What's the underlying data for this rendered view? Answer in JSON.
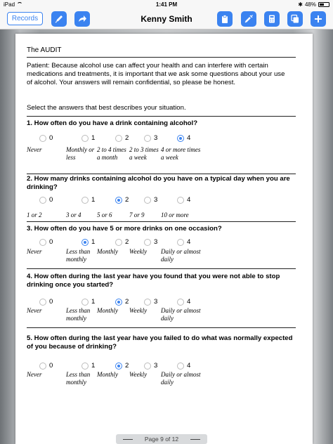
{
  "status_bar": {
    "device": "iPad",
    "time": "1:41 PM",
    "battery": "48%"
  },
  "toolbar": {
    "records_label": "Records",
    "title": "Kenny Smith"
  },
  "document": {
    "title": "The AUDIT",
    "intro": "Patient: Because alcohol use can affect your health and can interfere with certain medications and treatments, it is important that we ask some questions about your use of alcohol. Your answers will remain confidential, so please be honest.",
    "instruction": "Select the answers that best describes your situation.",
    "questions": [
      {
        "text": "1. How often do you have a drink containing alcohol?",
        "options": [
          "0",
          "1",
          "2",
          "3",
          "4"
        ],
        "labels": [
          "Never",
          "Monthly or less",
          "2 to 4 times a month",
          "2 to 3 times a week",
          "4 or more times a week"
        ],
        "selected": 4
      },
      {
        "text": "2. How many drinks containing alcohol do you have on a typical day when you are drinking?",
        "options": [
          "0",
          "1",
          "2",
          "3",
          "4"
        ],
        "labels": [
          "1 or 2",
          "3 or 4",
          "5 or 6",
          "7 or 9",
          "10 or more"
        ],
        "selected": 2
      },
      {
        "text": "3. How often do you have 5 or more drinks on one occasion?",
        "options": [
          "0",
          "1",
          "2",
          "3",
          "4"
        ],
        "labels": [
          "Never",
          "Less than monthly",
          "Monthly",
          "Weekly",
          "Daily or almost daily"
        ],
        "selected": 1
      },
      {
        "text": "4. How often during the last year have you found that you were not able to stop drinking once you started?",
        "options": [
          "0",
          "1",
          "2",
          "3",
          "4"
        ],
        "labels": [
          "Never",
          "Less than monthly",
          "Monthly",
          "Weekly",
          "Daily or almost daily"
        ],
        "selected": 2
      },
      {
        "text": "5. How often during the last year have you failed to do what was normally expected of you because of drinking?",
        "options": [
          "0",
          "1",
          "2",
          "3",
          "4"
        ],
        "labels": [
          "Never",
          "Less than monthly",
          "Monthly",
          "Weekly",
          "Daily or almost daily"
        ],
        "selected": 2
      }
    ]
  },
  "page_indicator": "Page 9 of 12",
  "colors": {
    "accent": "#3b83f0"
  }
}
